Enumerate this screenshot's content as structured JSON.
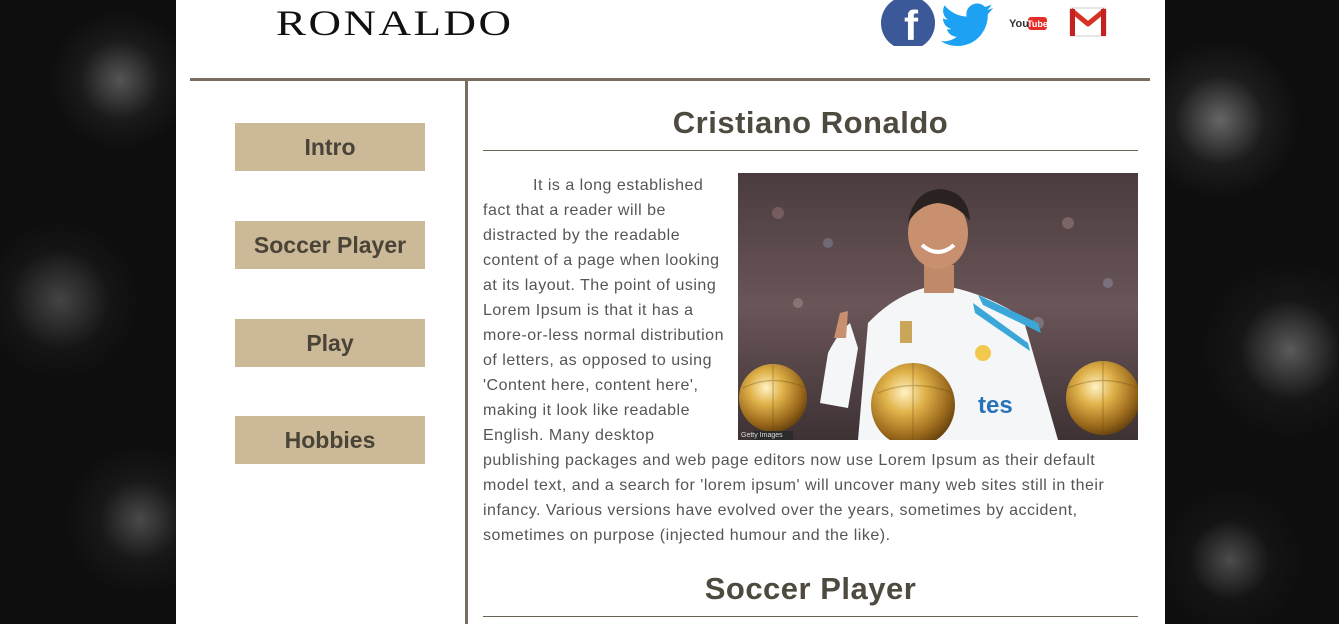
{
  "header": {
    "logo_text": "RONALDO",
    "social": [
      {
        "icon": "facebook-icon",
        "label": "f",
        "color": "#3b5998"
      },
      {
        "icon": "twitter-icon",
        "label": "",
        "color": "#1da1f2"
      },
      {
        "icon": "youtube-icon",
        "label": "You",
        "label2": "Tube",
        "color": "#e52d27"
      },
      {
        "icon": "gmail-icon",
        "label": "M",
        "color": "#d93025"
      }
    ]
  },
  "nav": {
    "items": [
      {
        "label": "Intro"
      },
      {
        "label": "Soccer Player"
      },
      {
        "label": "Play"
      },
      {
        "label": "Hobbies"
      }
    ]
  },
  "main": {
    "intro_title": "Cristiano Ronaldo",
    "intro_text": "It is a long established fact that a reader will be distracted by the readable content of a page when looking at its layout. The point of using Lorem Ipsum is that it has a more-or-less normal distribution of letters, as opposed to using 'Content here, content here', making it look like readable English. Many desktop publishing packages and web page editors now use Lorem Ipsum as their default model text, and a search for 'lorem ipsum' will uncover many web sites still in their infancy. Various versions have evolved over the years, sometimes by accident, sometimes on purpose (injected humour and the like).",
    "photo_credit": "Getty Images",
    "soccer_title": "Soccer Player"
  },
  "colors": {
    "nav_button_bg": "#cbb998",
    "rule": "#7a6e62",
    "heading": "#4f4a40"
  }
}
